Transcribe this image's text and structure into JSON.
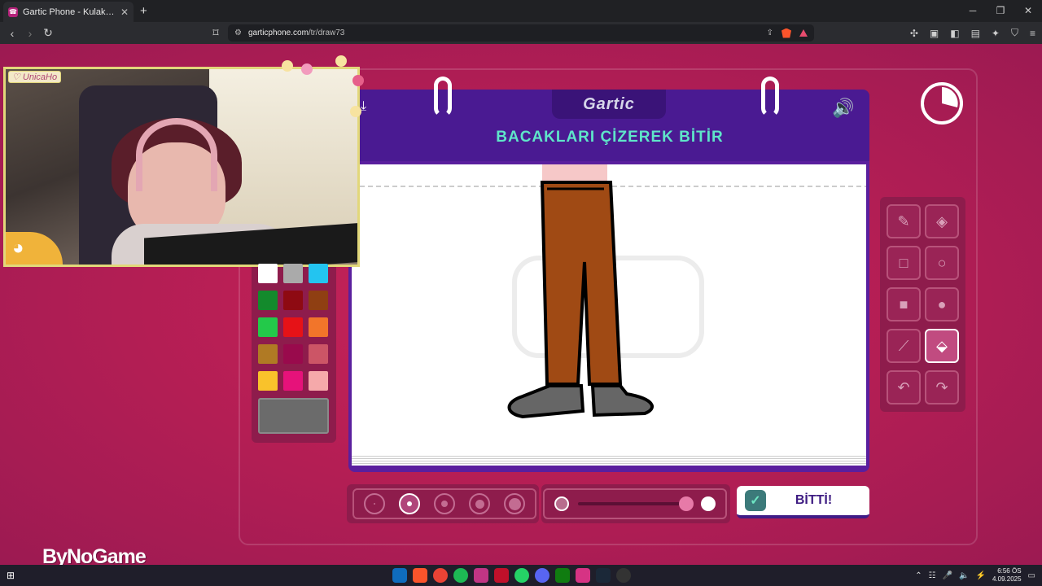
{
  "browser": {
    "tab_title": "Gartic Phone - Kulaktan Kulağa",
    "url_host": "garticphone.com",
    "url_path": "/tr/draw73"
  },
  "game": {
    "logo": "Gartic",
    "prompt": "BACAKLARI ÇİZEREK BİTİR",
    "done_label": "BİTTİ!",
    "palette_colors": [
      "#ffffff",
      "#aaaaaa",
      "#23c4f0",
      "#138a2c",
      "#8e0a12",
      "#8f3f12",
      "#23c94a",
      "#e61217",
      "#f2752a",
      "#b07a24",
      "#990a4c",
      "#cc5566",
      "#f9c22b",
      "#e6127a",
      "#f5a9aa"
    ],
    "selected_color": "#6b6b6b",
    "selected_size_index": 1,
    "opacity_percent": 100,
    "active_tool": "fill-bucket"
  },
  "stream": {
    "webcam_tag": "♡ UnicaHo",
    "watermark": "ByNoGame"
  },
  "taskbar": {
    "time": "6:56 ÖS",
    "date": "4.09.2025"
  }
}
